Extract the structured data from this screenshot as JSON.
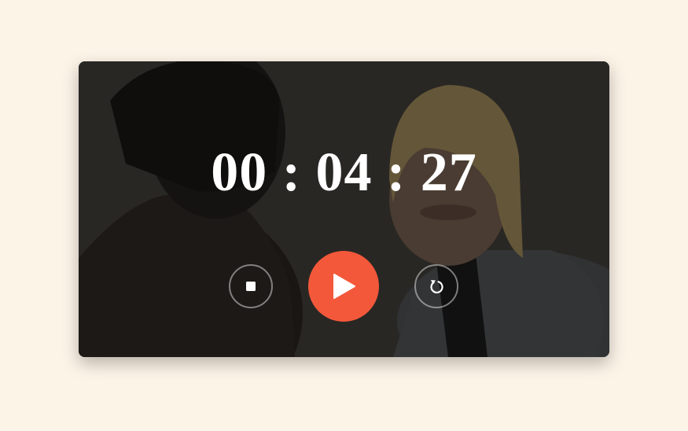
{
  "timer": {
    "hours": "00",
    "minutes": "04",
    "seconds": "27",
    "display": "00 : 04 : 27"
  },
  "controls": {
    "stop": {
      "icon": "stop-icon"
    },
    "play": {
      "icon": "play-icon",
      "color": "#f4583a"
    },
    "reset": {
      "icon": "reset-icon"
    }
  },
  "colors": {
    "page_background": "#fdf4e8",
    "accent": "#f4583a",
    "text": "#ffffff"
  }
}
